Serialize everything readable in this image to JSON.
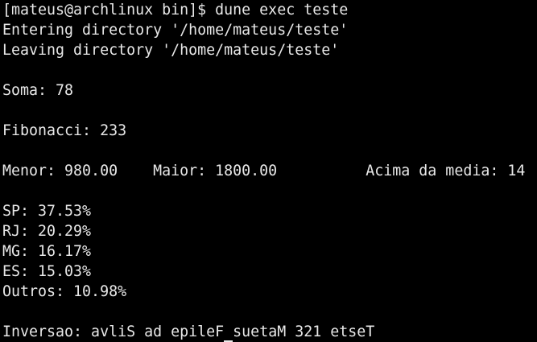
{
  "terminal": {
    "lines": [
      {
        "text": "[mateus@archlinux bin]$ dune exec teste"
      },
      {
        "text": "Entering directory '/home/mateus/teste'"
      },
      {
        "text": "Leaving directory '/home/mateus/teste'"
      },
      {
        "text": ""
      },
      {
        "text": "Soma: 78"
      },
      {
        "text": ""
      },
      {
        "text": "Fibonacci: 233"
      },
      {
        "text": ""
      },
      {
        "text": "Menor: 980.00    Maior: 1800.00          Acima da media: 14"
      },
      {
        "text": ""
      },
      {
        "text": "SP: 37.53%"
      },
      {
        "text": "RJ: 20.29%"
      },
      {
        "text": "MG: 16.17%"
      },
      {
        "text": "ES: 15.03%"
      },
      {
        "text": "Outros: 10.98%"
      },
      {
        "text": ""
      }
    ],
    "last_line_before_cursor": "Inversao: avliS ad epileF",
    "last_line_cursor_char": " ",
    "last_line_after_cursor": "suetaM 321 etseT"
  },
  "colors": {
    "background": "#000000",
    "foreground": "#e8e8e8"
  }
}
